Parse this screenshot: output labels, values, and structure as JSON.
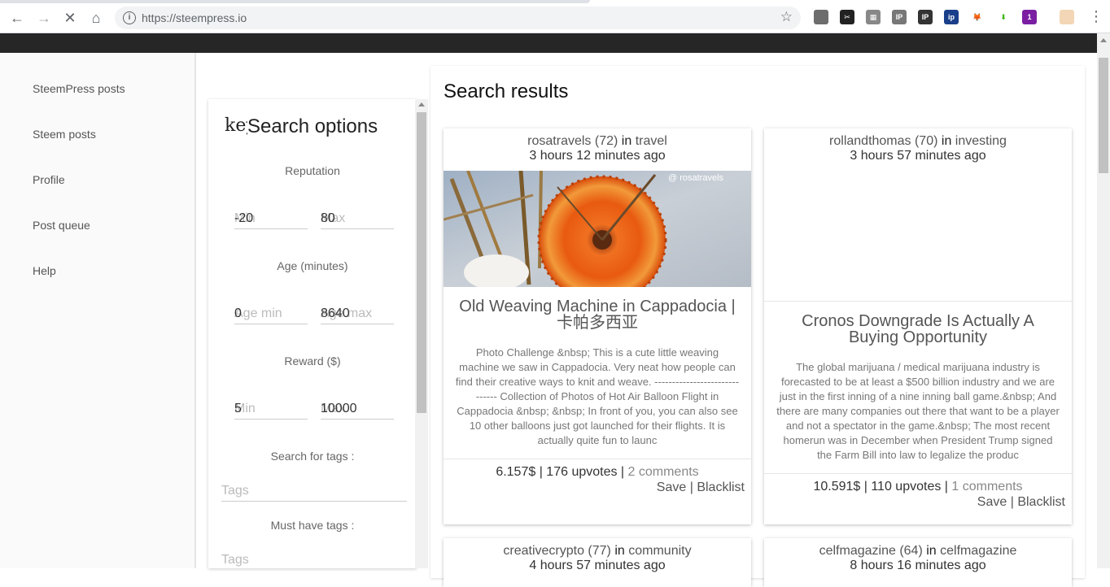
{
  "browser": {
    "url": "https://steempress.io",
    "extensions": [
      {
        "name": "chart-ext-icon",
        "label": "",
        "color": "#6d6d6d"
      },
      {
        "name": "scissors-ext-icon",
        "label": "✂",
        "color": "#222222"
      },
      {
        "name": "keyboard-ext-icon",
        "label": "▦",
        "color": "#888888"
      },
      {
        "name": "ip-search-ext-icon",
        "label": "IP",
        "color": "#777777"
      },
      {
        "name": "ip-ext-icon",
        "label": "IP",
        "color": "#333333"
      },
      {
        "name": "ip-blue-ext-icon",
        "label": "ip",
        "color": "#1a3f8a"
      },
      {
        "name": "fox-ext-icon",
        "label": "🦊",
        "color": "#ffffff"
      },
      {
        "name": "download-ext-icon",
        "label": "⬇",
        "color": "#ffffff"
      },
      {
        "name": "badge-ext-icon",
        "label": "1",
        "color": "#7b1fa2"
      },
      {
        "name": "profile-ext-icon",
        "label": "",
        "color": "#f3d6b5"
      }
    ]
  },
  "nav": {
    "items": [
      "SteemPress posts",
      "Steem posts",
      "Profile",
      "Post queue",
      "Help"
    ]
  },
  "options": {
    "icon_text": "key",
    "title": "Search options",
    "reputation_label": "Reputation",
    "rep_min_placeholder": "Min",
    "rep_min_value": "-20",
    "rep_max_placeholder": "Max",
    "rep_max_value": "80",
    "age_label": "Age (minutes)",
    "age_min_placeholder": "Age min",
    "age_min_value": "0",
    "age_max_placeholder": "Age max",
    "age_max_value": "8640",
    "reward_label": "Reward ($)",
    "reward_min_placeholder": "Min",
    "reward_min_value": "5",
    "reward_max_placeholder": "Max",
    "reward_max_value": "10000",
    "tags_label": "Search for tags :",
    "tags_placeholder": "Tags",
    "must_tags_label": "Must have tags :",
    "must_tags_placeholder": "Tags"
  },
  "results": {
    "heading": "Search results",
    "in_word": "in",
    "save_label": "Save",
    "blacklist_label": "Blacklist",
    "cards": [
      {
        "author": "rosatravels (72)",
        "category": "travel",
        "time": "3 hours 12 minutes ago",
        "watermark": "@ rosatravels",
        "title": "Old Weaving Machine in Cappadocia | 卡帕多西亚",
        "excerpt": "Photo Challenge &nbsp; This is a cute little weaving machine we saw in Cappadocia. Very neat how people can find their creative ways to knit and weave. ------------------------------ Collection of Photos of Hot Air Balloon Flight in Cappadocia &nbsp; &nbsp; In front of you, you can also see 10 other balloons just got launched for their flights. It is actually quite fun to launc",
        "payout": "6.157$",
        "upvotes": "176 upvotes",
        "comments": "2 comments"
      },
      {
        "author": "rollandthomas (70)",
        "category": "investing",
        "time": "3 hours 57 minutes ago",
        "title": "Cronos Downgrade Is Actually A Buying Opportunity",
        "excerpt": "The global marijuana / medical marijuana industry is forecasted to be at least a $500 billion industry and we are just in the first inning of a nine inning ball game.&nbsp; And there are many companies out there that want to be a player and not a spectator in the game.&nbsp; The most recent homerun was in December when President Trump signed the Farm Bill into law to legalize the produc",
        "payout": "10.591$",
        "upvotes": "110 upvotes",
        "comments": "1 comments"
      },
      {
        "author": "creativecrypto (77)",
        "category": "community",
        "time": "4 hours 57 minutes ago"
      },
      {
        "author": "celfmagazine (64)",
        "category": "celfmagazine",
        "time": "8 hours 16 minutes ago"
      }
    ]
  }
}
